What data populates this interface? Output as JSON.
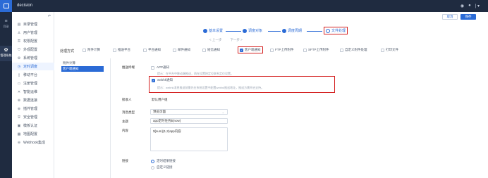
{
  "topbar": {
    "title": "decision",
    "icons": [
      "bell-icon",
      "user-icon"
    ],
    "user_label": "| ▾"
  },
  "rail": {
    "items": [
      {
        "label": "目录",
        "glyph": "≡"
      },
      {
        "label": "管理系统",
        "glyph": "✿"
      }
    ]
  },
  "sidebar": {
    "items": [
      {
        "label": "目录管理",
        "icon": "▤"
      },
      {
        "label": "用户管理",
        "icon": "♙"
      },
      {
        "label": "权限配置",
        "icon": "⚿"
      },
      {
        "label": "外观配置",
        "icon": "⛉"
      },
      {
        "label": "系统管理",
        "icon": "⚙"
      },
      {
        "label": "定时调度",
        "icon": "◷"
      },
      {
        "label": "移动平台",
        "icon": "▯"
      },
      {
        "label": "注册管理",
        "icon": "▭"
      },
      {
        "label": "智能运维",
        "icon": "✕"
      },
      {
        "label": "数据连接",
        "icon": "⊛"
      },
      {
        "label": "插件管理",
        "icon": "⊕"
      },
      {
        "label": "安全管理",
        "icon": "⛨"
      },
      {
        "label": "模板认证",
        "icon": "▣"
      },
      {
        "label": "地图配置",
        "icon": "▦"
      },
      {
        "label": "Webhook集成",
        "icon": "⊜"
      }
    ]
  },
  "header": {
    "cancel_label": "取消",
    "save_label": "保存"
  },
  "steps": [
    "基本设置",
    "调度对象",
    "调度周期",
    "文件处理"
  ],
  "pager": {
    "prev": "< 上一步",
    "next": "下一步 >"
  },
  "methods": {
    "label": "处理方式",
    "options": [
      {
        "label": "附件计算",
        "checked": false
      },
      {
        "label": "推送平台",
        "checked": false
      },
      {
        "label": "平台通知",
        "checked": false
      },
      {
        "label": "邮件通知",
        "checked": false
      },
      {
        "label": "短信通知",
        "checked": false
      },
      {
        "label": "客户端通知",
        "checked": true
      },
      {
        "label": "FTP上传附件",
        "checked": false
      },
      {
        "label": "SFTP上传附件",
        "checked": false
      },
      {
        "label": "自定义附件处理",
        "checked": false
      },
      {
        "label": "打印文件",
        "checked": false
      }
    ]
  },
  "left_list": [
    "附件计算",
    "客户端通知"
  ],
  "form": {
    "push_terminal_label": "推送终端",
    "app_label": "APP通知",
    "app_hint": "提示：在平台中移动端推送，再在设置按定位联系定位设置。",
    "webhook_label": "webhk通知",
    "webhook_hint": "提示：webhk消息推送前需先在系统设置中配置webhk推送地址，推送方需开启支持。",
    "receiver_label": "接收人",
    "receiver_value": "默认用户组",
    "message_type_label": "消息类型",
    "message_type_value": "预览页面",
    "subject_label": "主题",
    "subject_value": "app定时任务${now}",
    "content_label": "内容",
    "content_value": "${sum}(1,2)app内容",
    "link_label": "链接",
    "link_options": [
      {
        "label": "定时结果链接",
        "checked": true
      },
      {
        "label": "自定义链接",
        "checked": false
      }
    ]
  },
  "colors": {
    "accent": "#2b6bd6",
    "highlight": "#d42020",
    "sidebar_bg": "#1f2b40"
  }
}
